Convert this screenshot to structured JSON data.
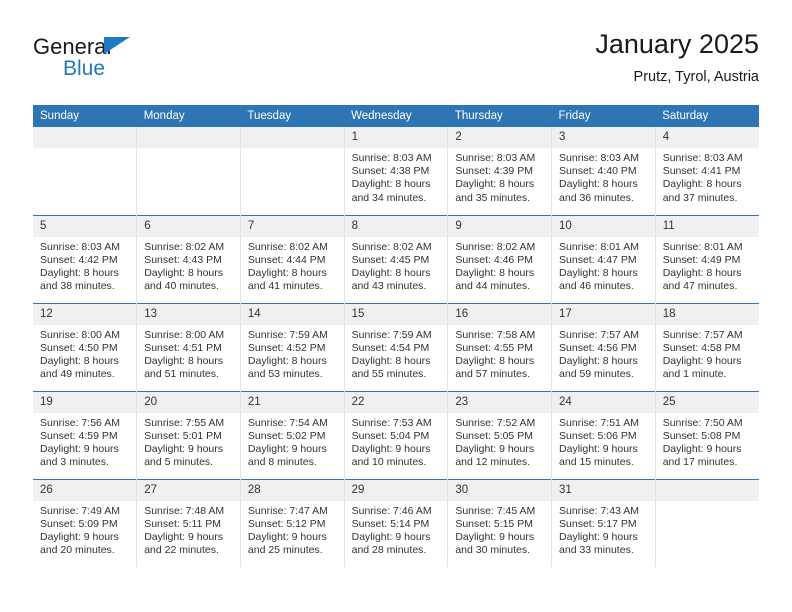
{
  "brand": {
    "line1": "General",
    "line2": "Blue",
    "triangle_icon": "blue-triangle-icon"
  },
  "header": {
    "title": "January 2025",
    "subtitle": "Prutz, Tyrol, Austria"
  },
  "colors": {
    "header_blue": "#2e75b6",
    "brand_blue": "#1f78c1",
    "daynum_bg": "#f0f0f0",
    "text": "#333333"
  },
  "weekdays": [
    "Sunday",
    "Monday",
    "Tuesday",
    "Wednesday",
    "Thursday",
    "Friday",
    "Saturday"
  ],
  "weeks": [
    [
      {
        "day": "",
        "empty": true
      },
      {
        "day": "",
        "empty": true
      },
      {
        "day": "",
        "empty": true
      },
      {
        "day": "1",
        "sunrise": "Sunrise: 8:03 AM",
        "sunset": "Sunset: 4:38 PM",
        "daylight1": "Daylight: 8 hours",
        "daylight2": "and 34 minutes."
      },
      {
        "day": "2",
        "sunrise": "Sunrise: 8:03 AM",
        "sunset": "Sunset: 4:39 PM",
        "daylight1": "Daylight: 8 hours",
        "daylight2": "and 35 minutes."
      },
      {
        "day": "3",
        "sunrise": "Sunrise: 8:03 AM",
        "sunset": "Sunset: 4:40 PM",
        "daylight1": "Daylight: 8 hours",
        "daylight2": "and 36 minutes."
      },
      {
        "day": "4",
        "sunrise": "Sunrise: 8:03 AM",
        "sunset": "Sunset: 4:41 PM",
        "daylight1": "Daylight: 8 hours",
        "daylight2": "and 37 minutes."
      }
    ],
    [
      {
        "day": "5",
        "sunrise": "Sunrise: 8:03 AM",
        "sunset": "Sunset: 4:42 PM",
        "daylight1": "Daylight: 8 hours",
        "daylight2": "and 38 minutes."
      },
      {
        "day": "6",
        "sunrise": "Sunrise: 8:02 AM",
        "sunset": "Sunset: 4:43 PM",
        "daylight1": "Daylight: 8 hours",
        "daylight2": "and 40 minutes."
      },
      {
        "day": "7",
        "sunrise": "Sunrise: 8:02 AM",
        "sunset": "Sunset: 4:44 PM",
        "daylight1": "Daylight: 8 hours",
        "daylight2": "and 41 minutes."
      },
      {
        "day": "8",
        "sunrise": "Sunrise: 8:02 AM",
        "sunset": "Sunset: 4:45 PM",
        "daylight1": "Daylight: 8 hours",
        "daylight2": "and 43 minutes."
      },
      {
        "day": "9",
        "sunrise": "Sunrise: 8:02 AM",
        "sunset": "Sunset: 4:46 PM",
        "daylight1": "Daylight: 8 hours",
        "daylight2": "and 44 minutes."
      },
      {
        "day": "10",
        "sunrise": "Sunrise: 8:01 AM",
        "sunset": "Sunset: 4:47 PM",
        "daylight1": "Daylight: 8 hours",
        "daylight2": "and 46 minutes."
      },
      {
        "day": "11",
        "sunrise": "Sunrise: 8:01 AM",
        "sunset": "Sunset: 4:49 PM",
        "daylight1": "Daylight: 8 hours",
        "daylight2": "and 47 minutes."
      }
    ],
    [
      {
        "day": "12",
        "sunrise": "Sunrise: 8:00 AM",
        "sunset": "Sunset: 4:50 PM",
        "daylight1": "Daylight: 8 hours",
        "daylight2": "and 49 minutes."
      },
      {
        "day": "13",
        "sunrise": "Sunrise: 8:00 AM",
        "sunset": "Sunset: 4:51 PM",
        "daylight1": "Daylight: 8 hours",
        "daylight2": "and 51 minutes."
      },
      {
        "day": "14",
        "sunrise": "Sunrise: 7:59 AM",
        "sunset": "Sunset: 4:52 PM",
        "daylight1": "Daylight: 8 hours",
        "daylight2": "and 53 minutes."
      },
      {
        "day": "15",
        "sunrise": "Sunrise: 7:59 AM",
        "sunset": "Sunset: 4:54 PM",
        "daylight1": "Daylight: 8 hours",
        "daylight2": "and 55 minutes."
      },
      {
        "day": "16",
        "sunrise": "Sunrise: 7:58 AM",
        "sunset": "Sunset: 4:55 PM",
        "daylight1": "Daylight: 8 hours",
        "daylight2": "and 57 minutes."
      },
      {
        "day": "17",
        "sunrise": "Sunrise: 7:57 AM",
        "sunset": "Sunset: 4:56 PM",
        "daylight1": "Daylight: 8 hours",
        "daylight2": "and 59 minutes."
      },
      {
        "day": "18",
        "sunrise": "Sunrise: 7:57 AM",
        "sunset": "Sunset: 4:58 PM",
        "daylight1": "Daylight: 9 hours",
        "daylight2": "and 1 minute."
      }
    ],
    [
      {
        "day": "19",
        "sunrise": "Sunrise: 7:56 AM",
        "sunset": "Sunset: 4:59 PM",
        "daylight1": "Daylight: 9 hours",
        "daylight2": "and 3 minutes."
      },
      {
        "day": "20",
        "sunrise": "Sunrise: 7:55 AM",
        "sunset": "Sunset: 5:01 PM",
        "daylight1": "Daylight: 9 hours",
        "daylight2": "and 5 minutes."
      },
      {
        "day": "21",
        "sunrise": "Sunrise: 7:54 AM",
        "sunset": "Sunset: 5:02 PM",
        "daylight1": "Daylight: 9 hours",
        "daylight2": "and 8 minutes."
      },
      {
        "day": "22",
        "sunrise": "Sunrise: 7:53 AM",
        "sunset": "Sunset: 5:04 PM",
        "daylight1": "Daylight: 9 hours",
        "daylight2": "and 10 minutes."
      },
      {
        "day": "23",
        "sunrise": "Sunrise: 7:52 AM",
        "sunset": "Sunset: 5:05 PM",
        "daylight1": "Daylight: 9 hours",
        "daylight2": "and 12 minutes."
      },
      {
        "day": "24",
        "sunrise": "Sunrise: 7:51 AM",
        "sunset": "Sunset: 5:06 PM",
        "daylight1": "Daylight: 9 hours",
        "daylight2": "and 15 minutes."
      },
      {
        "day": "25",
        "sunrise": "Sunrise: 7:50 AM",
        "sunset": "Sunset: 5:08 PM",
        "daylight1": "Daylight: 9 hours",
        "daylight2": "and 17 minutes."
      }
    ],
    [
      {
        "day": "26",
        "sunrise": "Sunrise: 7:49 AM",
        "sunset": "Sunset: 5:09 PM",
        "daylight1": "Daylight: 9 hours",
        "daylight2": "and 20 minutes."
      },
      {
        "day": "27",
        "sunrise": "Sunrise: 7:48 AM",
        "sunset": "Sunset: 5:11 PM",
        "daylight1": "Daylight: 9 hours",
        "daylight2": "and 22 minutes."
      },
      {
        "day": "28",
        "sunrise": "Sunrise: 7:47 AM",
        "sunset": "Sunset: 5:12 PM",
        "daylight1": "Daylight: 9 hours",
        "daylight2": "and 25 minutes."
      },
      {
        "day": "29",
        "sunrise": "Sunrise: 7:46 AM",
        "sunset": "Sunset: 5:14 PM",
        "daylight1": "Daylight: 9 hours",
        "daylight2": "and 28 minutes."
      },
      {
        "day": "30",
        "sunrise": "Sunrise: 7:45 AM",
        "sunset": "Sunset: 5:15 PM",
        "daylight1": "Daylight: 9 hours",
        "daylight2": "and 30 minutes."
      },
      {
        "day": "31",
        "sunrise": "Sunrise: 7:43 AM",
        "sunset": "Sunset: 5:17 PM",
        "daylight1": "Daylight: 9 hours",
        "daylight2": "and 33 minutes."
      },
      {
        "day": "",
        "empty": true
      }
    ]
  ]
}
